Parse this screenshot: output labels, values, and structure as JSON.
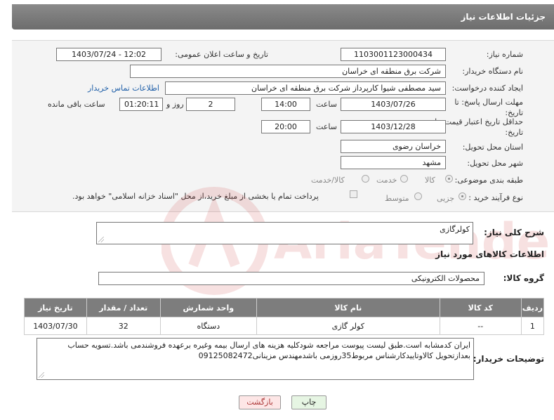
{
  "header": {
    "title": "جزئیات اطلاعات نیاز"
  },
  "form": {
    "need_number": {
      "label": "شماره نیاز:",
      "value": "1103001123000434"
    },
    "announce": {
      "label": "تاریخ و ساعت اعلان عمومی:",
      "value": "1403/07/24 - 12:02"
    },
    "buyer": {
      "label": "نام دستگاه خریدار:",
      "value": "شرکت برق منطقه ای خراسان"
    },
    "requester": {
      "label": "ایجاد کننده درخواست:",
      "value": "سید مصطفی شیوا کارپرداز شرکت برق منطقه ای خراسان",
      "contact_link": "اطلاعات تماس خریدار"
    },
    "deadline": {
      "label": "مهلت ارسال پاسخ: تا تاریخ:",
      "date": "1403/07/26",
      "time_label": "ساعت",
      "time": "14:00",
      "days": "2",
      "days_label": "روز و",
      "remaining": "01:20:11",
      "remaining_label": "ساعت باقی مانده"
    },
    "validity": {
      "label": "حداقل تاریخ اعتبار قیمت: تا تاریخ:",
      "date": "1403/12/28",
      "time_label": "ساعت",
      "time": "20:00"
    },
    "province": {
      "label": "استان محل تحویل:",
      "value": "خراسان رضوی"
    },
    "city": {
      "label": "شهر محل تحویل:",
      "value": "مشهد"
    },
    "category": {
      "label": "طبقه بندی موضوعی:",
      "options": [
        "کالا",
        "خدمت",
        "کالا/خدمت"
      ],
      "selected": "کالا"
    },
    "process": {
      "label": "نوع فرآیند خرید :",
      "options": [
        "جزیی",
        "متوسط"
      ],
      "selected": "جزیی",
      "note": "پرداخت تمام یا بخشی از مبلغ خرید،از محل \"اسناد خزانه اسلامی\" خواهد بود."
    }
  },
  "description": {
    "label": "شرح کلی نیاز:",
    "value": "کولرگازی"
  },
  "goods_section": {
    "title": "اطلاعات کالاهای مورد نیاز"
  },
  "goods_group": {
    "label": "گروه کالا:",
    "value": "محصولات الکترونیکی"
  },
  "table": {
    "headers": [
      "ردیف",
      "کد کالا",
      "نام کالا",
      "واحد شمارش",
      "تعداد / مقدار",
      "تاریخ نیاز"
    ],
    "rows": [
      [
        "1",
        "--",
        "کولر گازی",
        "دستگاه",
        "32",
        "1403/07/30"
      ]
    ]
  },
  "buyer_notes": {
    "label": "توضیحات خریدار:",
    "value": "ایران کدمشابه است.طبق لیست پیوست مراجعه شودکلیه هزینه های ارسال بیمه وغیره برعهده فروشندمی باشد.تسویه حساب بعدازتحویل کالاوتاییدکارشناس مربوط35روزمی باشدمهندس مزینانی09125082472"
  },
  "buttons": {
    "print": "چاپ",
    "back": "بازگشت"
  },
  "watermark": {
    "text": "AriaTender.neT"
  },
  "colors": {
    "header_bg": "#7a7a7a",
    "table_header_bg": "#7d7d7d",
    "link": "#1f5fa8",
    "back_button_bg": "#fde6e6",
    "print_button_bg": "#e6f5e3"
  }
}
